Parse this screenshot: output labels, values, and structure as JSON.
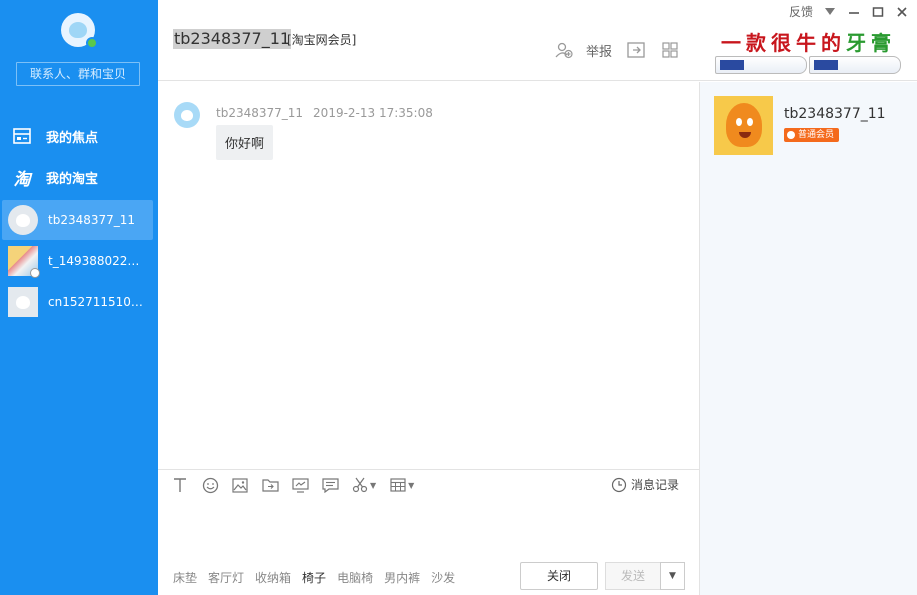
{
  "window": {
    "feedback": "反馈",
    "controls": [
      "dropdown-icon",
      "minimize-icon",
      "maximize-icon",
      "close-icon"
    ]
  },
  "sidebar": {
    "search_placeholder": "联系人、群和宝贝",
    "nav": [
      {
        "label": "我的焦点",
        "icon": "focus-icon"
      },
      {
        "label": "我的淘宝",
        "icon": "taobao-icon"
      }
    ],
    "contacts": [
      {
        "name": "tb2348377_11",
        "active": true
      },
      {
        "name": "t_1493880222..."
      },
      {
        "name": "cn1527115109..."
      }
    ],
    "accent": "#1a8ff0"
  },
  "header": {
    "name": "tb2348377_11",
    "member": "[淘宝网会员]",
    "report": "举报",
    "ad_text": "一款很牛的牙膏"
  },
  "chat": {
    "messages": [
      {
        "sender": "tb2348377_11",
        "time": "2019-2-13 17:35:08",
        "text": "你好啊"
      }
    ]
  },
  "input": {
    "toolbar": [
      "font-icon",
      "emoji-icon",
      "image-icon",
      "folder-icon",
      "screen-icon",
      "comment-icon",
      "scissors-icon",
      "calculator-icon"
    ],
    "history": "消息记录",
    "suggestions": [
      "床垫",
      "客厅灯",
      "收纳箱",
      "椅子",
      "电脑椅",
      "男内裤",
      "沙发"
    ],
    "close_label": "关闭",
    "send_label": "发送"
  },
  "profile": {
    "name": "tb2348377_11",
    "badge": "普通会员",
    "badge_color": "#f46a1c"
  }
}
